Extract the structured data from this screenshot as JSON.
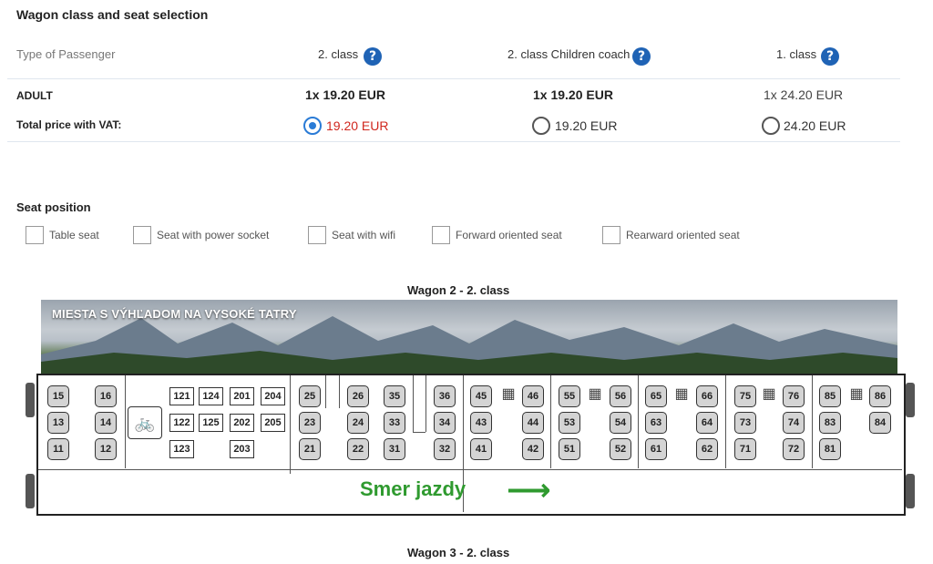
{
  "header": {
    "title": "Wagon class and seat selection",
    "passenger_type_label": "Type of Passenger"
  },
  "classes": [
    {
      "name": "2. class",
      "adult_price": "1x 19.20 EUR",
      "total": "19.20 EUR",
      "selected": true
    },
    {
      "name": "2. class Children coach",
      "adult_price": "1x 19.20 EUR",
      "total": "19.20 EUR",
      "selected": false
    },
    {
      "name": "1. class",
      "adult_price": "1x 24.20 EUR",
      "total": "24.20 EUR",
      "selected": false
    }
  ],
  "help_glyph": "?",
  "rows": {
    "adult_label": "ADULT",
    "total_label": "Total price with VAT:"
  },
  "seat_position": {
    "title": "Seat position",
    "options": [
      "Table seat",
      "Seat with power socket",
      "Seat with wifi",
      "Forward oriented seat",
      "Rearward oriented seat"
    ]
  },
  "wagons": {
    "wagon2_title": "Wagon 2 - 2. class",
    "wagon3_title": "Wagon 3 - 2. class",
    "banner_text": "MIESTA S VÝHĽADOM NA VYSOKÉ TATRY",
    "direction_text": "Smer jazdy",
    "direction_arrow": "⟶",
    "bike_glyph": "🚲",
    "table_glyph": "▦",
    "seats": [
      "15",
      "13",
      "11",
      "16",
      "14",
      "12",
      "25",
      "23",
      "21",
      "26",
      "24",
      "22",
      "35",
      "33",
      "31",
      "36",
      "34",
      "32",
      "45",
      "43",
      "41",
      "46",
      "44",
      "42",
      "55",
      "53",
      "51",
      "56",
      "54",
      "52",
      "65",
      "63",
      "61",
      "66",
      "64",
      "62",
      "75",
      "73",
      "71",
      "76",
      "74",
      "72",
      "85",
      "83",
      "81",
      "86",
      "84"
    ],
    "boxes": [
      "121",
      "124",
      "201",
      "204",
      "122",
      "125",
      "202",
      "205",
      "123",
      "203"
    ]
  },
  "colors": {
    "accent": "#1f63b5",
    "selected_price": "#d0271e",
    "radio_selected": "#2a7bd6",
    "direction": "#2f9a2f"
  }
}
